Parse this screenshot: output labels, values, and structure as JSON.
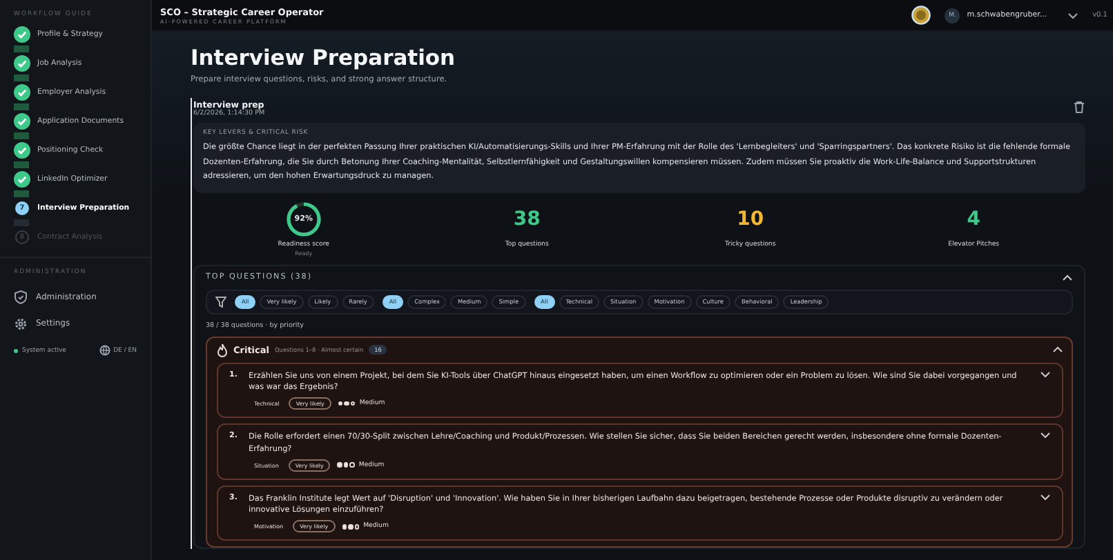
{
  "header": {
    "title": "SCO – Strategic Career Operator",
    "subtitle": "AI-POWERED CAREER PLATFORM",
    "user_initial": "M.",
    "user_name": "m.schwabengruber...",
    "version": "v0.1"
  },
  "sidebar": {
    "section_title": "WORKFLOW GUIDE",
    "steps": [
      {
        "label": "Profile & Strategy",
        "done": true,
        "selected": false
      },
      {
        "label": "Job Analysis",
        "done": true,
        "selected": false
      },
      {
        "label": "Employer Analysis",
        "done": true,
        "selected": false
      },
      {
        "label": "Application Documents",
        "done": true,
        "selected": false
      },
      {
        "label": "Positioning Check",
        "done": true,
        "selected": false
      },
      {
        "label": "LinkedIn Optimizer",
        "done": true,
        "selected": false
      },
      {
        "label": "Interview Preparation",
        "number": "7",
        "done": false,
        "selected": true
      },
      {
        "label": "Contract Analysis",
        "number": "8",
        "done": false,
        "selected": false
      }
    ],
    "admin_title": "ADMINISTRATION",
    "admin_items": [
      {
        "label": "Administration"
      },
      {
        "label": "Settings"
      }
    ],
    "system_status": "System active",
    "language": "DE / EN"
  },
  "page": {
    "title": "Interview Preparation",
    "description": "Prepare interview questions, risks, and strong answer structure.",
    "entry": {
      "title": "Interview prep",
      "date": "6/2/2026, 1:14:30 PM"
    },
    "risk": {
      "label": "KEY LEVERS & CRITICAL RISK",
      "text": "Die größte Chance liegt in der perfekten Passung Ihrer praktischen KI/Automatisierungs-Skills und Ihrer PM-Erfahrung mit der Rolle des 'Lernbegleiters' und 'Sparringspartners'. Das konkrete Risiko ist die fehlende formale Dozenten-Erfahrung, die Sie durch Betonung Ihrer Coaching-Mentalität, Selbstlernfähigkeit und Gestaltungswillen kompensieren müssen. Zudem müssen Sie proaktiv die Work-Life-Balance und Supportstrukturen adressieren, um den hohen Erwartungsdruck zu managen."
    },
    "stats": [
      {
        "kind": "ring",
        "value": "92%",
        "level": 0.92,
        "label": "Readiness score",
        "sub": "Ready"
      },
      {
        "kind": "number",
        "value": "38",
        "label": "Top questions",
        "color": "#3ec98a"
      },
      {
        "kind": "number",
        "value": "10",
        "label": "Tricky questions",
        "color": "#f2b632"
      },
      {
        "kind": "number",
        "value": "4",
        "label": "Elevator Pitches",
        "color": "#3ec98a"
      }
    ]
  },
  "questions": {
    "title": "TOP QUESTIONS (38)",
    "expanded": true,
    "filter_groups": [
      [
        {
          "label": "All",
          "selected": true
        },
        {
          "label": "Very likely",
          "selected": false
        },
        {
          "label": "Likely",
          "selected": false
        },
        {
          "label": "Rarely",
          "selected": false
        }
      ],
      [
        {
          "label": "All",
          "selected": true
        },
        {
          "label": "Complex",
          "selected": false
        },
        {
          "label": "Medium",
          "selected": false
        },
        {
          "label": "Simple",
          "selected": false
        }
      ],
      [
        {
          "label": "All",
          "selected": true
        },
        {
          "label": "Technical",
          "selected": false
        },
        {
          "label": "Situation",
          "selected": false
        },
        {
          "label": "Motivation",
          "selected": false
        },
        {
          "label": "Culture",
          "selected": false
        },
        {
          "label": "Behavioral",
          "selected": false
        },
        {
          "label": "Leadership",
          "selected": false
        }
      ]
    ],
    "count": "38 / 38 questions · by priority",
    "group": {
      "title": "Critical",
      "subtitle": "Questions 1–8 · Almost certain",
      "badge": "16",
      "expanded": true,
      "items": [
        {
          "number": "1.",
          "text": "Erzählen Sie uns von einem Projekt, bei dem Sie KI-Tools über ChatGPT hinaus eingesetzt haben, um einen Workflow zu optimieren oder ein Problem zu lösen. Wie sind Sie dabei vorgegangen und was war das Ergebnis?",
          "category": "Technical",
          "likelihood": "Very likely",
          "stars": 2,
          "difficulty": "Medium"
        },
        {
          "number": "2.",
          "text": "Die Rolle erfordert einen 70/30-Split zwischen Lehre/Coaching und Produkt/Prozessen. Wie stellen Sie sicher, dass Sie beiden Bereichen gerecht werden, insbesondere ohne formale Dozenten-Erfahrung?",
          "category": "Situation",
          "likelihood": "Very likely",
          "stars": 2,
          "difficulty": "Medium"
        },
        {
          "number": "3.",
          "text": "Das Franklin Institute legt Wert auf 'Disruption' und 'Innovation'. Wie haben Sie in Ihrer bisherigen Laufbahn dazu beigetragen, bestehende Prozesse oder Produkte disruptiv zu verändern oder innovative Lösungen einzuführen?",
          "category": "Motivation",
          "likelihood": "Very likely",
          "stars": 2,
          "difficulty": "Medium"
        }
      ]
    }
  }
}
